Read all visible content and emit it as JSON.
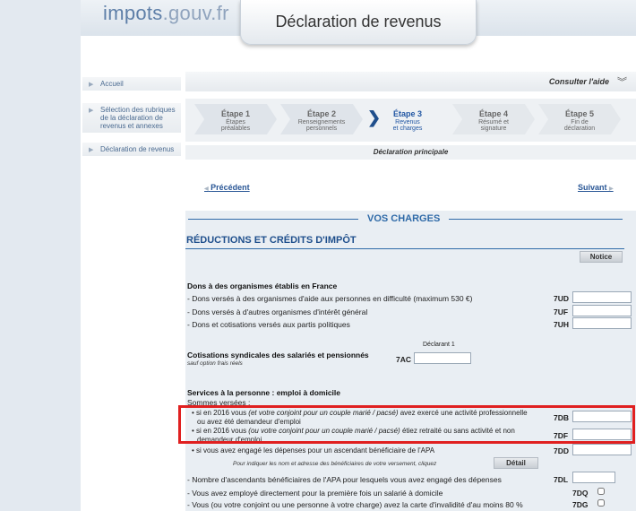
{
  "header": {
    "logo_main": "impots",
    "logo_tld": ".gouv.fr",
    "banner_title": "Déclaration de revenus"
  },
  "sidebar": {
    "items": [
      {
        "label": "Accueil"
      },
      {
        "label": "Sélection des rubriques de la déclaration de revenus et annexes"
      },
      {
        "label": "Déclaration de revenus"
      }
    ]
  },
  "help": {
    "label": "Consulter l'aide",
    "icon": "double-chevron-down-icon"
  },
  "steps": [
    {
      "num": "Étape 1",
      "label1": "Étapes",
      "label2": "préalables",
      "state": "done"
    },
    {
      "num": "Étape 2",
      "label1": "Renseignements",
      "label2": "personnels",
      "state": "done"
    },
    {
      "num": "Étape 3",
      "label1": "Revenus",
      "label2": "et charges",
      "state": "current"
    },
    {
      "num": "Étape 4",
      "label1": "Résumé et",
      "label2": "signature",
      "state": "todo"
    },
    {
      "num": "Étape 5",
      "label1": "Fin de",
      "label2": "déclaration",
      "state": "todo"
    }
  ],
  "declaration_label": "Déclaration principale",
  "nav": {
    "prev": "Précédent",
    "next": "Suivant"
  },
  "main": {
    "section_title": "VOS CHARGES",
    "subsection_title": "RÉDUCTIONS ET CRÉDITS D'IMPÔT",
    "notice_button": "Notice",
    "dons": {
      "title": "Dons à des organismes établis en France",
      "rows": [
        {
          "label": "- Dons versés à des organismes d'aide aux personnes en difficulté (maximum 530 €)",
          "code": "7UD",
          "value": ""
        },
        {
          "label": "- Dons versés à d'autres organismes d'intérêt général",
          "code": "7UF",
          "value": ""
        },
        {
          "label": "- Dons et cotisations versés aux partis politiques",
          "code": "7UH",
          "value": ""
        }
      ]
    },
    "cotisations": {
      "column_header": "Déclarant 1",
      "title": "Cotisations syndicales des salariés et pensionnés",
      "subtitle": "sauf option frais réels",
      "code": "7AC",
      "value": ""
    },
    "services": {
      "title": "Services à la personne : emploi à domicile",
      "sommes": "Sommes versées :",
      "row_7db_a": "• si en 2016 vous ",
      "row_7db_b": "(et votre conjoint pour un couple marié / pacsé)",
      "row_7db_c": " avez exercé une activité professionnelle",
      "row_7db_d": "ou avez été demandeur d'emploi",
      "code_7db": "7DB",
      "row_7df_a": "• si en 2016 vous ",
      "row_7df_b": "(ou votre conjoint pour un couple marié / pacsé)",
      "row_7df_c": " étiez retraité ou sans activité et non",
      "row_7df_d": "demandeur d'emploi",
      "code_7df": "7DF",
      "row_7dd": "• si vous avez engagé les dépenses pour un ascendant bénéficiaire de l'APA",
      "code_7dd": "7DD",
      "note_7dd": "Pour indiquer les nom et adresse des bénéficiaires de votre versement, cliquez",
      "detail_button": "Détail",
      "row_7dl": "- Nombre d'ascendants bénéficiaires de l'APA pour lesquels vous avez engagé des dépenses",
      "code_7dl": "7DL",
      "row_7dq": "- Vous avez employé directement pour la première fois un salarié à domicile",
      "code_7dq": "7DQ",
      "row_7dg": "- Vous (ou votre conjoint ou une personne à votre charge) avez la carte d'invalidité d'au moins 80 %",
      "code_7dg": "7DG"
    }
  }
}
